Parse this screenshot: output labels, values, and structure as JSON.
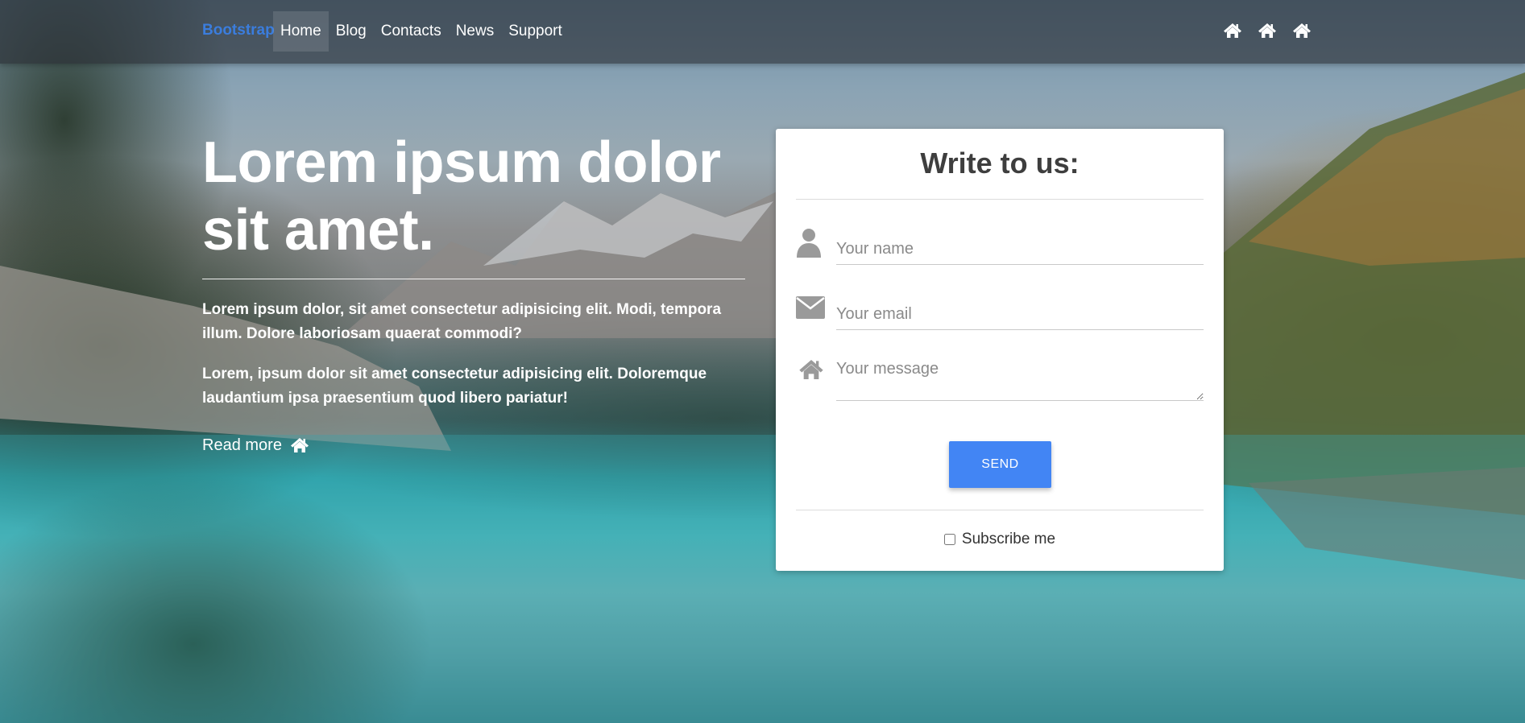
{
  "navbar": {
    "brand": "Bootstrap",
    "links": [
      "Home",
      "Blog",
      "Contacts",
      "News",
      "Support"
    ],
    "active_link": "Home",
    "icons": [
      "home-icon",
      "home-icon",
      "home-icon"
    ],
    "brand_color": "#3b7ddd"
  },
  "hero": {
    "title": "Lorem ipsum dolor sit amet.",
    "paragraph_1": "Lorem ipsum dolor, sit amet consectetur adipisicing elit. Modi, tempora illum. Dolore laboriosam quaerat commodi?",
    "paragraph_2": "Lorem, ipsum dolor sit amet consectetur adipisicing elit. Doloremque laudantium ipsa praesentium quod libero pariatur!",
    "read_more": "Read more",
    "read_more_icon": "home-icon"
  },
  "contact_form": {
    "title": "Write to us:",
    "name_placeholder": "Your name",
    "email_placeholder": "Your email",
    "message_placeholder": "Your message",
    "name_icon": "user-icon",
    "email_icon": "envelope-icon",
    "message_icon": "home-icon",
    "send_label": "SEND",
    "send_color": "#4285f4",
    "subscribe_label": "Subscribe me",
    "subscribe_checked": false
  }
}
